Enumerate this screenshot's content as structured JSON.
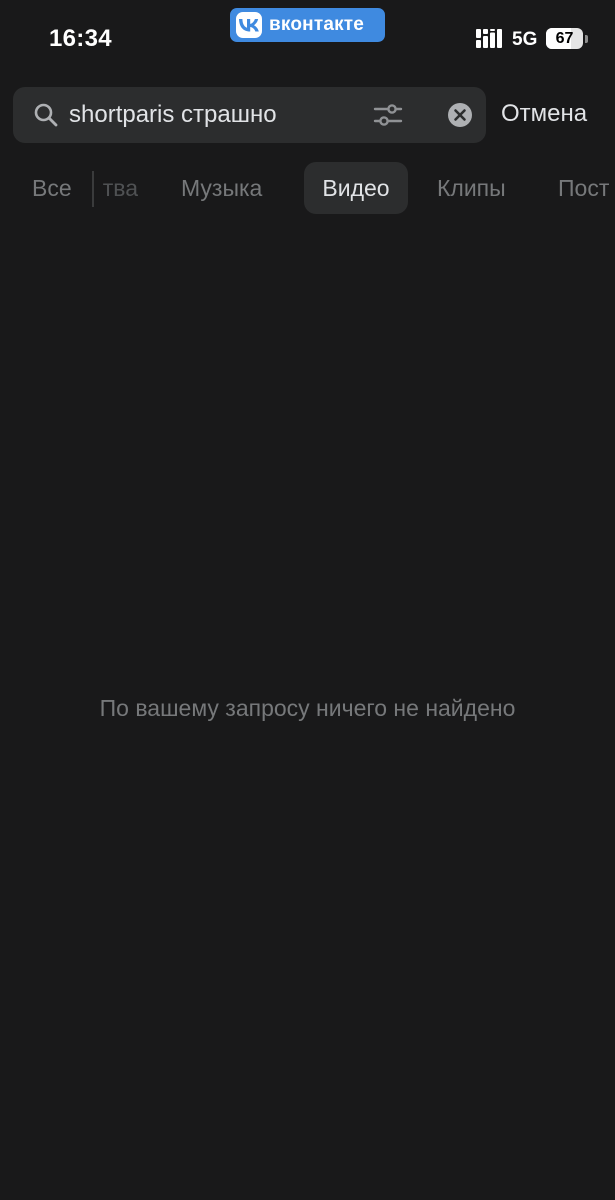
{
  "status_bar": {
    "time": "16:34",
    "app_badge": {
      "label": "вконтакте",
      "color": "#3f8ae0",
      "icon": "vk-logo-icon"
    },
    "signal_icon": "cellular-signal-icon",
    "network": "5G",
    "battery_level": "67",
    "battery_fraction": 0.67
  },
  "search": {
    "query": "shortparis страшно",
    "search_icon": "search-icon",
    "filter_icon": "filter-sliders-icon",
    "clear_icon": "clear-x-icon",
    "cancel_label": "Отмена"
  },
  "tabs": [
    {
      "label": "Все",
      "active": false
    },
    {
      "label": "Сообщества",
      "visible_fragment": "тва",
      "active": false
    },
    {
      "label": "Музыка",
      "active": false
    },
    {
      "label": "Видео",
      "active": true
    },
    {
      "label": "Клипы",
      "active": false
    },
    {
      "label": "Пост",
      "active": false
    }
  ],
  "results": {
    "empty_message": "По вашему запросу ничего не найдено"
  },
  "colors": {
    "background": "#19191a",
    "surface": "#2c2d2e",
    "text_primary": "#e1e3e6",
    "text_secondary": "#76787a",
    "accent": "#3f8ae0"
  }
}
